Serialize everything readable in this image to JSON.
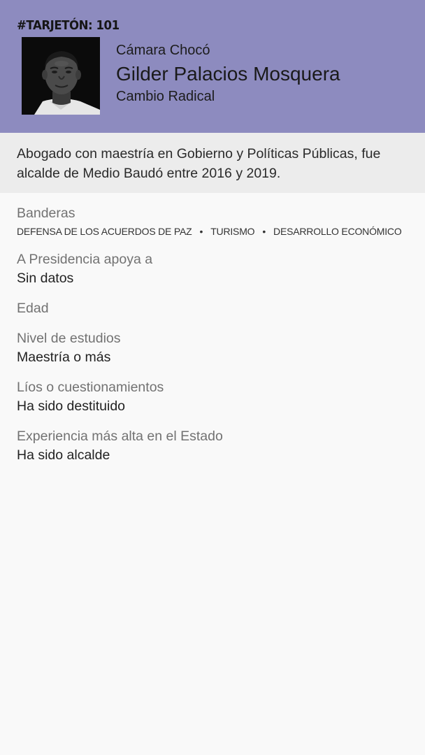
{
  "header": {
    "tag": "#TARJETÓN: 101",
    "chamber": "Cámara Chocó",
    "name": "Gilder Palacios Mosquera",
    "party": "Cambio Radical",
    "background_color": "#8d8bbf"
  },
  "bio": "Abogado con maestría en Gobierno y Políticas Públicas, fue alcalde de Medio Baudó entre 2016 y 2019.",
  "fields": {
    "banderas": {
      "label": "Banderas",
      "items": [
        "DEFENSA DE LOS ACUERDOS DE PAZ",
        "TURISMO",
        "DESARROLLO ECONÓMICO"
      ],
      "separator": "•"
    },
    "presidencia": {
      "label": "A Presidencia apoya a",
      "value": "Sin datos"
    },
    "edad": {
      "label": "Edad"
    },
    "estudios": {
      "label": "Nivel de estudios",
      "value": "Maestría o más"
    },
    "lios": {
      "label": "Líos o cuestionamientos",
      "value": "Ha sido destituido"
    },
    "experiencia": {
      "label": "Experiencia más alta en el Estado",
      "value": "Ha sido alcalde"
    }
  }
}
